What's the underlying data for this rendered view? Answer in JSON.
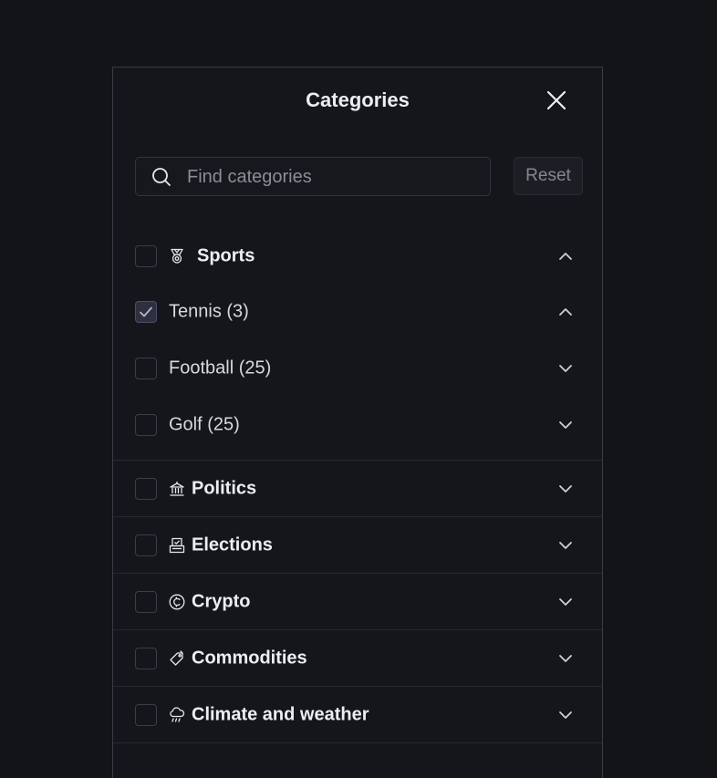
{
  "dialog": {
    "title": "Categories",
    "close_icon": "close-icon"
  },
  "search": {
    "placeholder": "Find categories",
    "value": "",
    "icon": "search-icon",
    "reset_label": "Reset"
  },
  "categories": [
    {
      "label": "Sports",
      "icon": "medal-icon",
      "checked": false,
      "expanded": true,
      "subcategories": [
        {
          "label": "Tennis (3)",
          "checked": true,
          "expanded": true
        },
        {
          "label": "Football (25)",
          "checked": false,
          "expanded": false
        },
        {
          "label": "Golf (25)",
          "checked": false,
          "expanded": false
        }
      ]
    },
    {
      "label": "Politics",
      "icon": "capitol-icon",
      "checked": false,
      "expanded": false
    },
    {
      "label": "Elections",
      "icon": "ballot-box-icon",
      "checked": false,
      "expanded": false
    },
    {
      "label": "Crypto",
      "icon": "crypto-coin-icon",
      "checked": false,
      "expanded": false
    },
    {
      "label": "Commodities",
      "icon": "commodity-tag-icon",
      "checked": false,
      "expanded": false
    },
    {
      "label": "Climate and weather",
      "icon": "cloud-rain-icon",
      "checked": false,
      "expanded": false
    }
  ],
  "colors": {
    "background": "#131418",
    "panel": "#15161b",
    "border": "#3a3c44",
    "text": "#eceef1",
    "muted": "#8b8d96"
  }
}
